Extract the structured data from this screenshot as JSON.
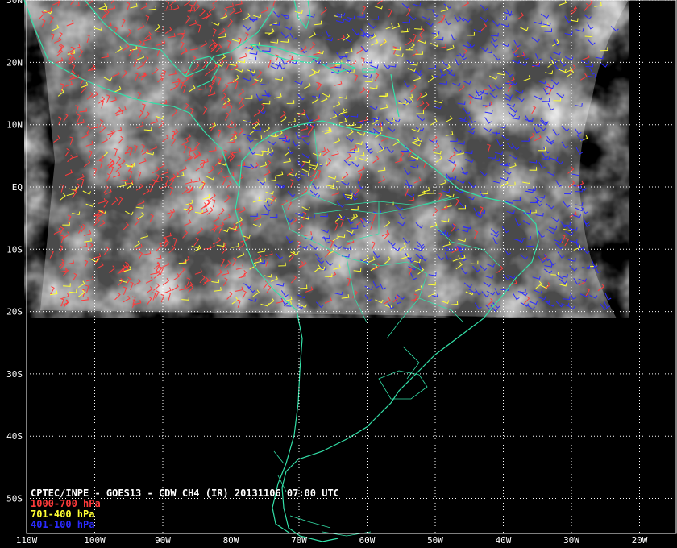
{
  "map": {
    "title": "CPTEC/INPE - GOES13 - CDW CH4 (IR) 20131106 07:00 UTC",
    "legend": [
      {
        "label": "1000-700 hPa",
        "color": "#ff3b3b"
      },
      {
        "label": "701-400 hPa",
        "color": "#ffff33"
      },
      {
        "label": "401-100 hPa",
        "color": "#2b2bff"
      }
    ],
    "lat_labels": [
      "30N",
      "20N",
      "10N",
      "EQ",
      "10S",
      "20S",
      "30S",
      "40S",
      "50S"
    ],
    "lon_labels": [
      "110W",
      "100W",
      "90W",
      "80W",
      "70W",
      "60W",
      "50W",
      "40W",
      "30W",
      "20W"
    ],
    "colors": {
      "background": "#000000",
      "coastline": "#33e0a8",
      "grid": "#ffffff",
      "imagery": "#505050"
    },
    "extent": {
      "lon_min": -110,
      "lon_max": -16,
      "lat_min": -55,
      "lat_max": 30
    }
  }
}
